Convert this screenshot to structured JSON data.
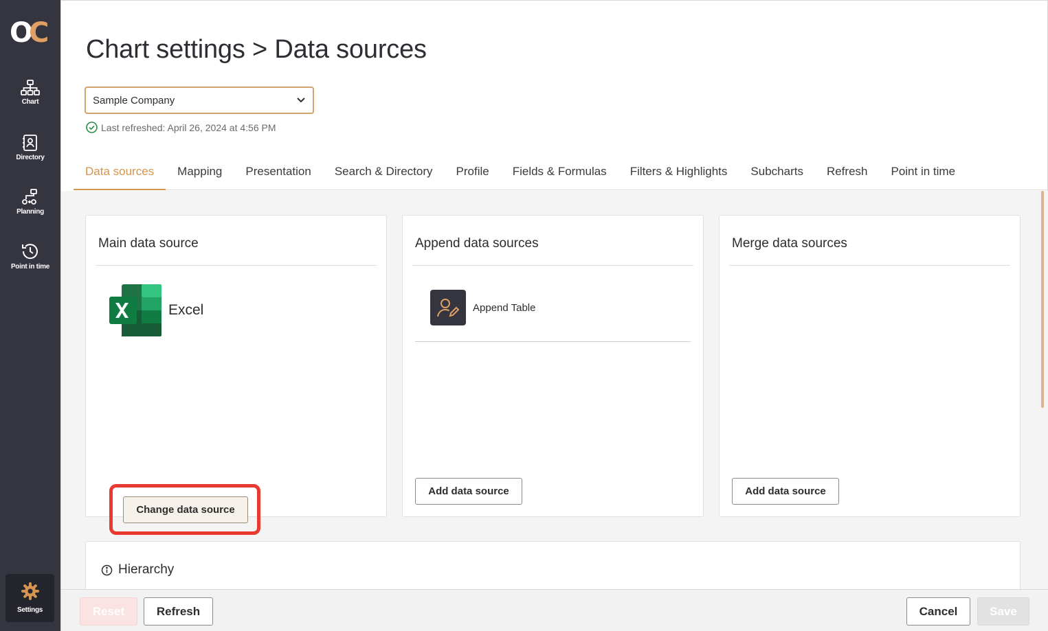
{
  "sidebar": {
    "logo_icon": "oc-logo-icon",
    "items": [
      {
        "label": "Chart",
        "icon": "org-chart-icon"
      },
      {
        "label": "Directory",
        "icon": "directory-icon"
      },
      {
        "label": "Planning",
        "icon": "planning-icon"
      },
      {
        "label": "Point in time",
        "icon": "history-icon"
      }
    ],
    "settings": {
      "label": "Settings",
      "icon": "gear-icon"
    }
  },
  "header": {
    "title": "Chart settings > Data sources",
    "company_select": {
      "value": "Sample Company"
    },
    "last_refreshed": "Last refreshed: April 26, 2024 at 4:56 PM"
  },
  "tabs": [
    {
      "label": "Data sources",
      "active": true
    },
    {
      "label": "Mapping"
    },
    {
      "label": "Presentation"
    },
    {
      "label": "Search & Directory"
    },
    {
      "label": "Profile"
    },
    {
      "label": "Fields & Formulas"
    },
    {
      "label": "Filters & Highlights"
    },
    {
      "label": "Subcharts"
    },
    {
      "label": "Refresh"
    },
    {
      "label": "Point in time"
    }
  ],
  "main_source": {
    "title": "Main data source",
    "source_name": "Excel",
    "button_label": "Change data source"
  },
  "append_sources": {
    "title": "Append data sources",
    "items": [
      {
        "name": "Append Table"
      }
    ],
    "button_label": "Add data source"
  },
  "merge_sources": {
    "title": "Merge data sources",
    "button_label": "Add data source"
  },
  "hierarchy": {
    "title": "Hierarchy"
  },
  "footer": {
    "reset_label": "Reset",
    "refresh_label": "Refresh",
    "cancel_label": "Cancel",
    "save_label": "Save"
  },
  "colors": {
    "sidebar_bg": "#35353f",
    "accent": "#d3954f",
    "highlight": "#e83a30"
  }
}
